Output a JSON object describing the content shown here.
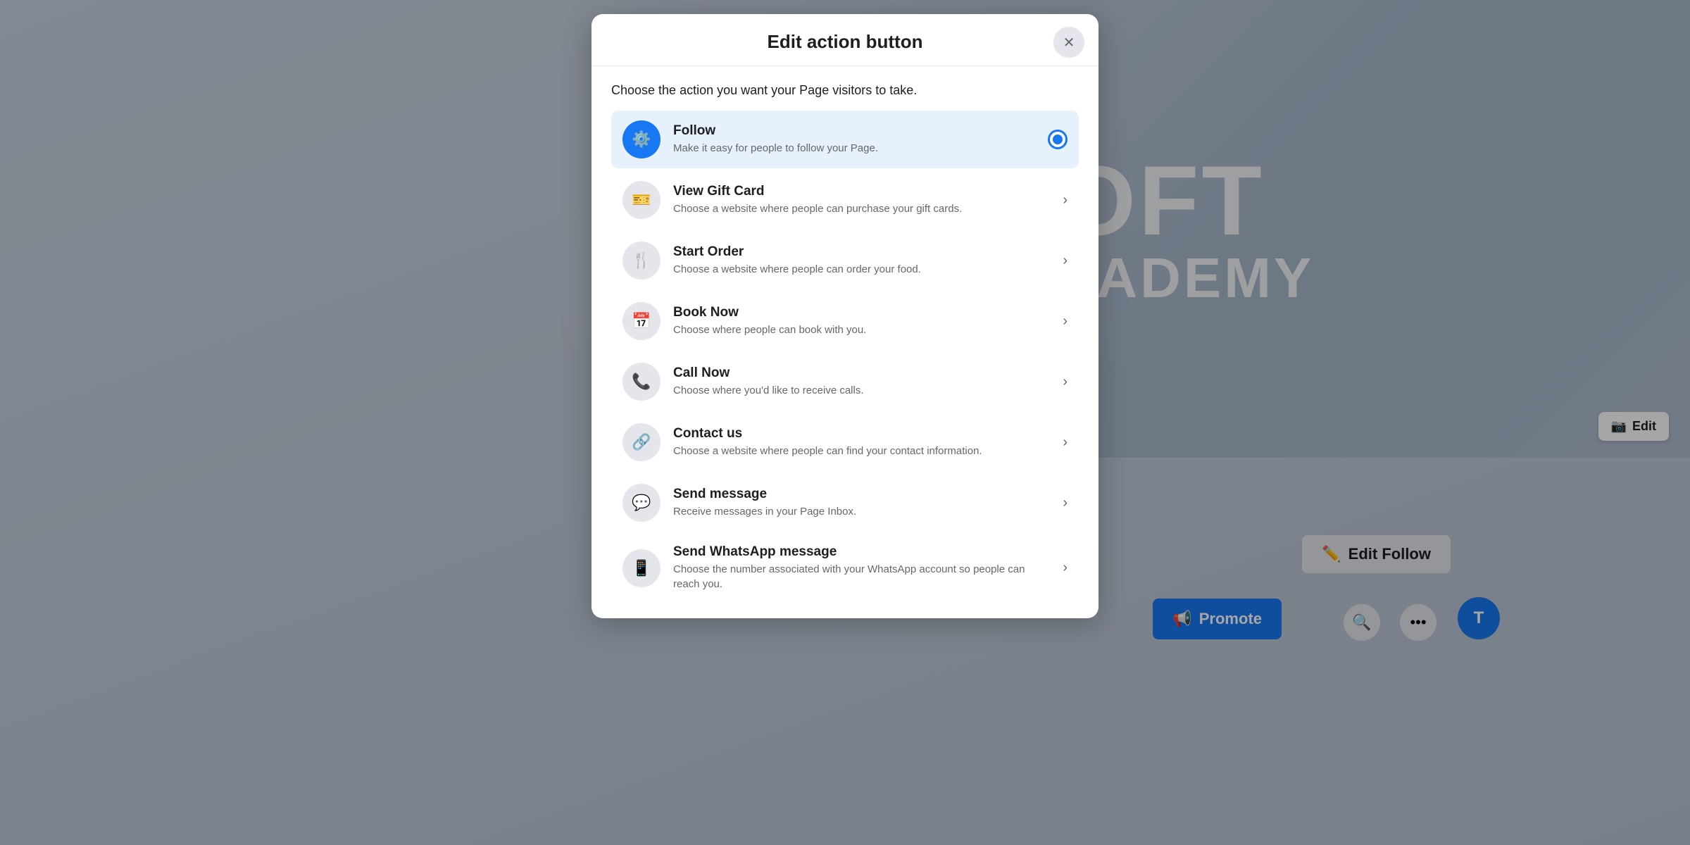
{
  "background": {
    "cover_text_line1": "OFT",
    "cover_text_line2": "ACADEMY",
    "edit_photo_label": "Edit",
    "edit_follow_label": "Edit Follow",
    "promote_label": "Promote",
    "avatar_initial": "T"
  },
  "modal": {
    "title": "Edit action button",
    "subtitle": "Choose the action you want your Page visitors to take.",
    "close_label": "×",
    "actions": [
      {
        "id": "follow",
        "title": "Follow",
        "description": "Make it easy for people to follow your Page.",
        "icon_type": "gear",
        "icon_blue": true,
        "selected": true
      },
      {
        "id": "view-gift-card",
        "title": "View Gift Card",
        "description": "Choose a website where people can purchase your gift cards.",
        "icon_type": "gift",
        "icon_blue": false,
        "selected": false
      },
      {
        "id": "start-order",
        "title": "Start Order",
        "description": "Choose a website where people can order your food.",
        "icon_type": "utensils",
        "icon_blue": false,
        "selected": false
      },
      {
        "id": "book-now",
        "title": "Book Now",
        "description": "Choose where people can book with you.",
        "icon_type": "calendar",
        "icon_blue": false,
        "selected": false
      },
      {
        "id": "call-now",
        "title": "Call Now",
        "description": "Choose where you'd like to receive calls.",
        "icon_type": "phone",
        "icon_blue": false,
        "selected": false
      },
      {
        "id": "contact-us",
        "title": "Contact us",
        "description": "Choose a website where people can find your contact information.",
        "icon_type": "link",
        "icon_blue": false,
        "selected": false
      },
      {
        "id": "send-message",
        "title": "Send message",
        "description": "Receive messages in your Page Inbox.",
        "icon_type": "messenger",
        "icon_blue": false,
        "selected": false
      },
      {
        "id": "send-whatsapp",
        "title": "Send WhatsApp message",
        "description": "Choose the number associated with your WhatsApp account so people can reach you.",
        "icon_type": "whatsapp",
        "icon_blue": false,
        "selected": false
      }
    ]
  }
}
